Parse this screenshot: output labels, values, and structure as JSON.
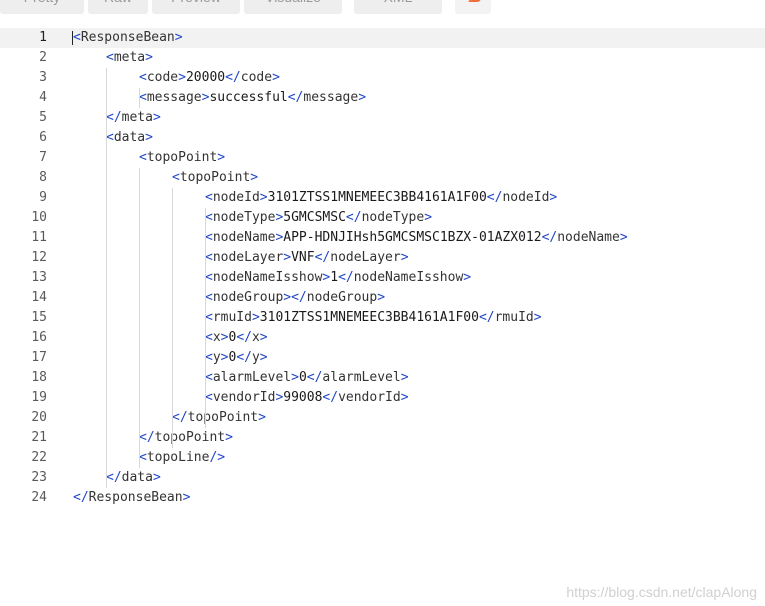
{
  "toolbar": {
    "buttons": [
      {
        "label": "Pretty"
      },
      {
        "label": "Raw"
      },
      {
        "label": "Preview"
      },
      {
        "label": "Visualize"
      },
      {
        "label": "XML"
      }
    ],
    "accent": "#f26b3a"
  },
  "editor": {
    "active_line": 1,
    "lines": [
      {
        "n": "1",
        "indent": 0,
        "parts": [
          [
            "b",
            "<"
          ],
          [
            "t",
            "ResponseBean"
          ],
          [
            "b",
            ">"
          ]
        ]
      },
      {
        "n": "2",
        "indent": 1,
        "parts": [
          [
            "b",
            "<"
          ],
          [
            "t",
            "meta"
          ],
          [
            "b",
            ">"
          ]
        ]
      },
      {
        "n": "3",
        "indent": 2,
        "parts": [
          [
            "b",
            "<"
          ],
          [
            "t",
            "code"
          ],
          [
            "b",
            ">"
          ],
          [
            "v",
            "20000"
          ],
          [
            "b",
            "</"
          ],
          [
            "t",
            "code"
          ],
          [
            "b",
            ">"
          ]
        ]
      },
      {
        "n": "4",
        "indent": 2,
        "parts": [
          [
            "b",
            "<"
          ],
          [
            "t",
            "message"
          ],
          [
            "b",
            ">"
          ],
          [
            "v",
            "successful"
          ],
          [
            "b",
            "</"
          ],
          [
            "t",
            "message"
          ],
          [
            "b",
            ">"
          ]
        ]
      },
      {
        "n": "5",
        "indent": 1,
        "parts": [
          [
            "b",
            "</"
          ],
          [
            "t",
            "meta"
          ],
          [
            "b",
            ">"
          ]
        ]
      },
      {
        "n": "6",
        "indent": 1,
        "parts": [
          [
            "b",
            "<"
          ],
          [
            "t",
            "data"
          ],
          [
            "b",
            ">"
          ]
        ]
      },
      {
        "n": "7",
        "indent": 2,
        "parts": [
          [
            "b",
            "<"
          ],
          [
            "t",
            "topoPoint"
          ],
          [
            "b",
            ">"
          ]
        ]
      },
      {
        "n": "8",
        "indent": 3,
        "parts": [
          [
            "b",
            "<"
          ],
          [
            "t",
            "topoPoint"
          ],
          [
            "b",
            ">"
          ]
        ]
      },
      {
        "n": "9",
        "indent": 4,
        "parts": [
          [
            "b",
            "<"
          ],
          [
            "t",
            "nodeId"
          ],
          [
            "b",
            ">"
          ],
          [
            "v",
            "3101ZTSS1MNEMEEC3BB4161A1F00"
          ],
          [
            "b",
            "</"
          ],
          [
            "t",
            "nodeId"
          ],
          [
            "b",
            ">"
          ]
        ]
      },
      {
        "n": "10",
        "indent": 4,
        "parts": [
          [
            "b",
            "<"
          ],
          [
            "t",
            "nodeType"
          ],
          [
            "b",
            ">"
          ],
          [
            "v",
            "5GMCSMSC"
          ],
          [
            "b",
            "</"
          ],
          [
            "t",
            "nodeType"
          ],
          [
            "b",
            ">"
          ]
        ]
      },
      {
        "n": "11",
        "indent": 4,
        "parts": [
          [
            "b",
            "<"
          ],
          [
            "t",
            "nodeName"
          ],
          [
            "b",
            ">"
          ],
          [
            "v",
            "APP-HDNJIHsh5GMCSMSC1BZX-01AZX012"
          ],
          [
            "b",
            "</"
          ],
          [
            "t",
            "nodeName"
          ],
          [
            "b",
            ">"
          ]
        ]
      },
      {
        "n": "12",
        "indent": 4,
        "parts": [
          [
            "b",
            "<"
          ],
          [
            "t",
            "nodeLayer"
          ],
          [
            "b",
            ">"
          ],
          [
            "v",
            "VNF"
          ],
          [
            "b",
            "</"
          ],
          [
            "t",
            "nodeLayer"
          ],
          [
            "b",
            ">"
          ]
        ]
      },
      {
        "n": "13",
        "indent": 4,
        "parts": [
          [
            "b",
            "<"
          ],
          [
            "t",
            "nodeNameIsshow"
          ],
          [
            "b",
            ">"
          ],
          [
            "v",
            "1"
          ],
          [
            "b",
            "</"
          ],
          [
            "t",
            "nodeNameIsshow"
          ],
          [
            "b",
            ">"
          ]
        ]
      },
      {
        "n": "14",
        "indent": 4,
        "parts": [
          [
            "b",
            "<"
          ],
          [
            "t",
            "nodeGroup"
          ],
          [
            "b",
            ">"
          ],
          [
            "b",
            "</"
          ],
          [
            "t",
            "nodeGroup"
          ],
          [
            "b",
            ">"
          ]
        ]
      },
      {
        "n": "15",
        "indent": 4,
        "parts": [
          [
            "b",
            "<"
          ],
          [
            "t",
            "rmuId"
          ],
          [
            "b",
            ">"
          ],
          [
            "v",
            "3101ZTSS1MNEMEEC3BB4161A1F00"
          ],
          [
            "b",
            "</"
          ],
          [
            "t",
            "rmuId"
          ],
          [
            "b",
            ">"
          ]
        ]
      },
      {
        "n": "16",
        "indent": 4,
        "parts": [
          [
            "b",
            "<"
          ],
          [
            "t",
            "x"
          ],
          [
            "b",
            ">"
          ],
          [
            "v",
            "0"
          ],
          [
            "b",
            "</"
          ],
          [
            "t",
            "x"
          ],
          [
            "b",
            ">"
          ]
        ]
      },
      {
        "n": "17",
        "indent": 4,
        "parts": [
          [
            "b",
            "<"
          ],
          [
            "t",
            "y"
          ],
          [
            "b",
            ">"
          ],
          [
            "v",
            "0"
          ],
          [
            "b",
            "</"
          ],
          [
            "t",
            "y"
          ],
          [
            "b",
            ">"
          ]
        ]
      },
      {
        "n": "18",
        "indent": 4,
        "parts": [
          [
            "b",
            "<"
          ],
          [
            "t",
            "alarmLevel"
          ],
          [
            "b",
            ">"
          ],
          [
            "v",
            "0"
          ],
          [
            "b",
            "</"
          ],
          [
            "t",
            "alarmLevel"
          ],
          [
            "b",
            ">"
          ]
        ]
      },
      {
        "n": "19",
        "indent": 4,
        "parts": [
          [
            "b",
            "<"
          ],
          [
            "t",
            "vendorId"
          ],
          [
            "b",
            ">"
          ],
          [
            "v",
            "99008"
          ],
          [
            "b",
            "</"
          ],
          [
            "t",
            "vendorId"
          ],
          [
            "b",
            ">"
          ]
        ]
      },
      {
        "n": "20",
        "indent": 3,
        "parts": [
          [
            "b",
            "</"
          ],
          [
            "t",
            "topoPoint"
          ],
          [
            "b",
            ">"
          ]
        ]
      },
      {
        "n": "21",
        "indent": 2,
        "parts": [
          [
            "b",
            "</"
          ],
          [
            "t",
            "topoPoint"
          ],
          [
            "b",
            ">"
          ]
        ]
      },
      {
        "n": "22",
        "indent": 2,
        "parts": [
          [
            "b",
            "<"
          ],
          [
            "t",
            "topoLine"
          ],
          [
            "b",
            "/>"
          ]
        ]
      },
      {
        "n": "23",
        "indent": 1,
        "parts": [
          [
            "b",
            "</"
          ],
          [
            "t",
            "data"
          ],
          [
            "b",
            ">"
          ]
        ]
      },
      {
        "n": "24",
        "indent": 0,
        "parts": [
          [
            "b",
            "</"
          ],
          [
            "t",
            "ResponseBean"
          ],
          [
            "b",
            ">"
          ]
        ]
      }
    ]
  },
  "watermark": "https://blog.csdn.net/clapAlong",
  "icons": {
    "wrap_button": "wrap-lines-icon"
  }
}
